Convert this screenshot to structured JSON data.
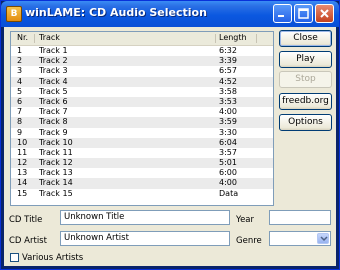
{
  "window": {
    "app_icon_letter": "B",
    "title": "winLAME: CD Audio Selection"
  },
  "tracklist": {
    "columns": {
      "nr": "Nr.",
      "track": "Track",
      "length": "Length"
    },
    "rows": [
      {
        "nr": "1",
        "track": "Track 1",
        "length": "6:32"
      },
      {
        "nr": "2",
        "track": "Track 2",
        "length": "3:39"
      },
      {
        "nr": "3",
        "track": "Track 3",
        "length": "6:57"
      },
      {
        "nr": "4",
        "track": "Track 4",
        "length": "4:52"
      },
      {
        "nr": "5",
        "track": "Track 5",
        "length": "3:58"
      },
      {
        "nr": "6",
        "track": "Track 6",
        "length": "3:53"
      },
      {
        "nr": "7",
        "track": "Track 7",
        "length": "4:00"
      },
      {
        "nr": "8",
        "track": "Track 8",
        "length": "3:59"
      },
      {
        "nr": "9",
        "track": "Track 9",
        "length": "3:30"
      },
      {
        "nr": "10",
        "track": "Track 10",
        "length": "6:04"
      },
      {
        "nr": "11",
        "track": "Track 11",
        "length": "3:57"
      },
      {
        "nr": "12",
        "track": "Track 12",
        "length": "5:01"
      },
      {
        "nr": "13",
        "track": "Track 13",
        "length": "6:00"
      },
      {
        "nr": "14",
        "track": "Track 14",
        "length": "4:00"
      },
      {
        "nr": "15",
        "track": "Track 15",
        "length": "Data"
      }
    ]
  },
  "buttons": {
    "close": "Close",
    "play": "Play",
    "stop": "Stop",
    "freedb": "freedb.org",
    "options": "Options"
  },
  "fields": {
    "cd_title_label": "CD Title",
    "cd_title_value": "Unknown Title",
    "cd_artist_label": "CD Artist",
    "cd_artist_value": "Unknown Artist",
    "year_label": "Year",
    "year_value": "",
    "genre_label": "Genre",
    "genre_value": "",
    "various_artists_label": "Various Artists",
    "various_artists_checked": false
  },
  "colors": {
    "titlebar": "#0b58e0",
    "client_bg": "#ece9d8",
    "list_border": "#7f9db9"
  }
}
